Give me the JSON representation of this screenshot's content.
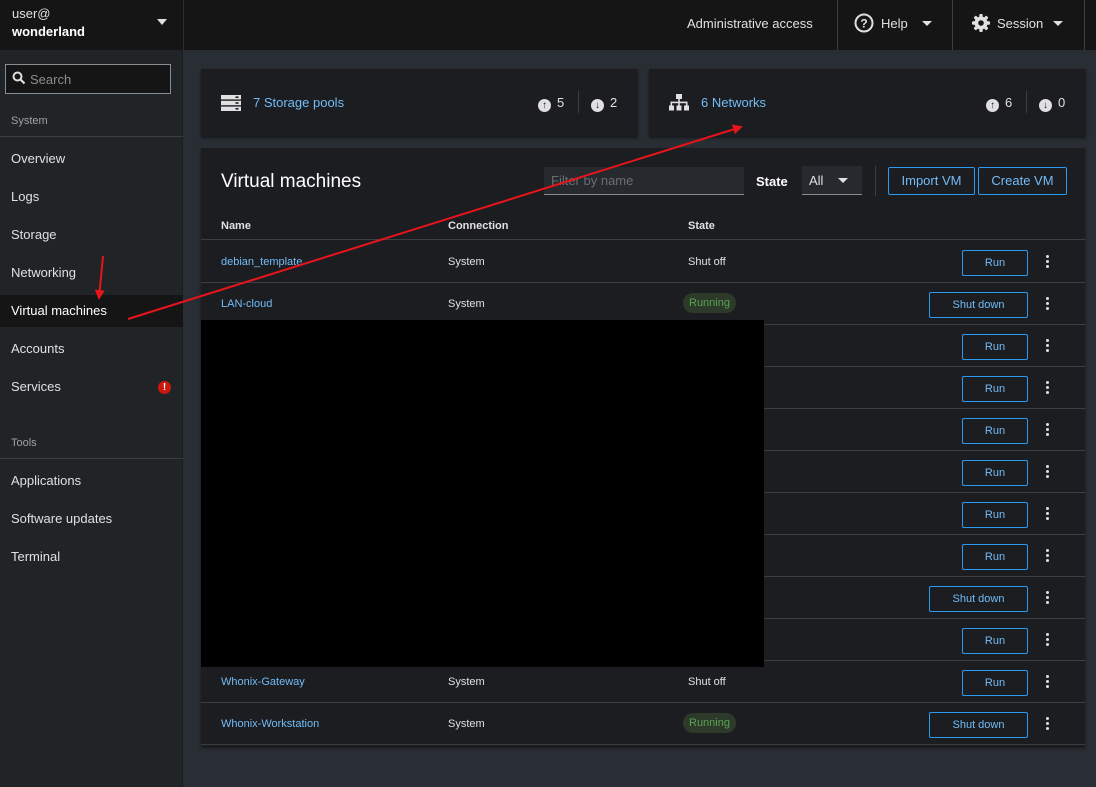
{
  "host": {
    "user": "user@",
    "hostname": "wonderland"
  },
  "search": {
    "placeholder": "Search"
  },
  "sidebar": {
    "system_label": "System",
    "tools_label": "Tools",
    "system_items": [
      {
        "label": "Overview"
      },
      {
        "label": "Logs"
      },
      {
        "label": "Storage"
      },
      {
        "label": "Networking"
      },
      {
        "label": "Virtual machines",
        "active": true
      },
      {
        "label": "Accounts"
      },
      {
        "label": "Services",
        "badge": "!"
      }
    ],
    "tools_items": [
      {
        "label": "Applications"
      },
      {
        "label": "Software updates"
      },
      {
        "label": "Terminal"
      }
    ]
  },
  "topbar": {
    "admin": "Administrative access",
    "help": "Help",
    "session": "Session"
  },
  "storage_card": {
    "link": "7 Storage pools",
    "up": "5",
    "down": "2"
  },
  "networks_card": {
    "link": "6 Networks",
    "up": "6",
    "down": "0"
  },
  "vm_panel": {
    "title": "Virtual machines",
    "filter_placeholder": "Filter by name",
    "state_label": "State",
    "state_value": "All",
    "import_label": "Import VM",
    "create_label": "Create VM",
    "columns": [
      "Name",
      "Connection",
      "State"
    ],
    "rows": [
      {
        "name": "debian_template",
        "connection": "System",
        "state": "Shut off",
        "action": "Run"
      },
      {
        "name": "LAN-cloud",
        "connection": "System",
        "state": "Running",
        "action": "Shut down"
      },
      {
        "name": "",
        "connection": "",
        "state": "",
        "action": "Run"
      },
      {
        "name": "",
        "connection": "",
        "state": "",
        "action": "Run"
      },
      {
        "name": "",
        "connection": "",
        "state": "",
        "action": "Run"
      },
      {
        "name": "",
        "connection": "",
        "state": "",
        "action": "Run"
      },
      {
        "name": "",
        "connection": "",
        "state": "",
        "action": "Run"
      },
      {
        "name": "",
        "connection": "",
        "state": "",
        "action": "Run"
      },
      {
        "name": "",
        "connection": "",
        "state": "",
        "action": "Shut down"
      },
      {
        "name": "",
        "connection": "",
        "state": "",
        "action": "Run"
      },
      {
        "name": "Whonix-Gateway",
        "connection": "System",
        "state": "Shut off",
        "action": "Run"
      },
      {
        "name": "Whonix-Workstation",
        "connection": "System",
        "state": "Running",
        "action": "Shut down"
      }
    ]
  },
  "colors": {
    "link": "#73bcf7",
    "accent": "#2b9af3",
    "annotation": "#e8141b",
    "running": "#5ba352",
    "error": "#c9190b"
  }
}
